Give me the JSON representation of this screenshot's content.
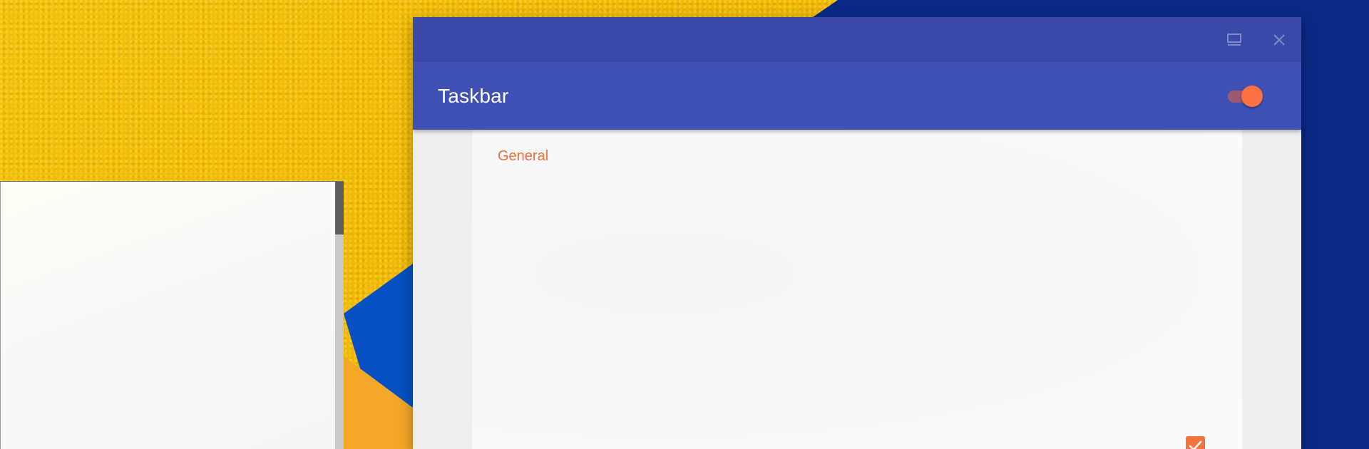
{
  "window": {
    "app_title": "Taskbar",
    "master_switch_on": true
  },
  "settings": {
    "section_title": "General",
    "checkbox_checked": true
  },
  "icons": {
    "restore": "restore-icon",
    "close": "close-icon",
    "check": "check-icon"
  },
  "colors": {
    "titlebar": "#3b4aa9",
    "appbar": "#3f51b5",
    "accent": "#ff7043",
    "section_header": "#f26b3a"
  }
}
